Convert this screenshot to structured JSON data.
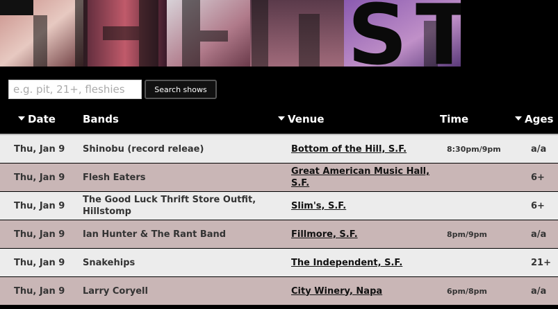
{
  "banner": {
    "title": "THE LIST"
  },
  "search": {
    "placeholder": "e.g. pit, 21+, fleshies",
    "button_label": "Search shows"
  },
  "header": {
    "date": "Date",
    "bands": "Bands",
    "venue": "Venue",
    "time": "Time",
    "ages": "Ages"
  },
  "rows": [
    {
      "date": "Thu, Jan 9",
      "bands": "Shinobu (record releae)",
      "venue": "Bottom of the Hill, S.F.",
      "time": "8:30pm/9pm",
      "ages": "a/a",
      "shade": "light"
    },
    {
      "date": "Thu, Jan 9",
      "bands": "Flesh Eaters",
      "venue": "Great American Music Hall, S.F.",
      "time": "",
      "ages": "6+",
      "shade": "dark"
    },
    {
      "date": "Thu, Jan 9",
      "bands": "The Good Luck Thrift Store Outfit, Hillstomp",
      "venue": "Slim's, S.F.",
      "time": "",
      "ages": "6+",
      "shade": "light"
    },
    {
      "date": "Thu, Jan 9",
      "bands": "Ian Hunter & The Rant Band",
      "venue": "Fillmore, S.F.",
      "time": "8pm/9pm",
      "ages": "a/a",
      "shade": "dark"
    },
    {
      "date": "Thu, Jan 9",
      "bands": "Snakehips",
      "venue": "The Independent, S.F.",
      "time": "",
      "ages": "21+",
      "shade": "light"
    },
    {
      "date": "Thu, Jan 9",
      "bands": "Larry Coryell",
      "venue": "City Winery, Napa",
      "time": "6pm/8pm",
      "ages": "a/a",
      "shade": "dark"
    }
  ],
  "colors": {
    "row_light": "#ececec",
    "row_dark": "#c9b6b6",
    "background": "#000000"
  }
}
